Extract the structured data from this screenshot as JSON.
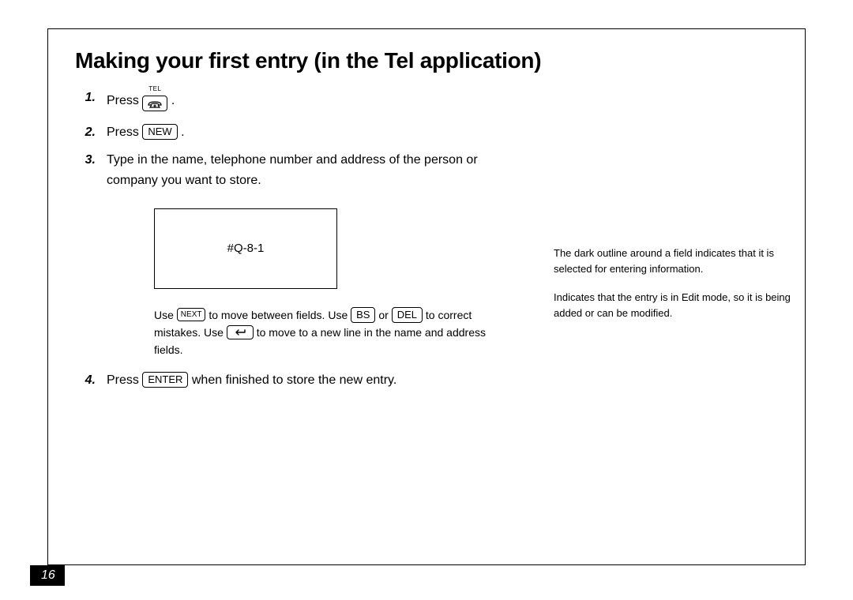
{
  "page_number": "16",
  "heading": "Making your first entry (in the Tel application)",
  "tel_label": "TEL",
  "steps": {
    "1": {
      "num": "1.",
      "press": "Press",
      "after": "."
    },
    "2": {
      "num": "2.",
      "press": "Press",
      "key": "NEW",
      "after": "."
    },
    "3": {
      "num": "3.",
      "text": "Type in the name, telephone number and address of the person or company you want to store."
    },
    "4": {
      "num": "4.",
      "press": "Press",
      "key": "ENTER",
      "after": " when finished to store the new entry."
    }
  },
  "screen_placeholder": "#Q-8-1",
  "sub": {
    "use": "Use ",
    "next": "NEXT",
    "t1": " to move between fields. Use ",
    "bs": "BS",
    "or": " or ",
    "del": "DEL",
    "t2": " to correct mistakes. Use ",
    "t3": " to move to a new line in the name and address fields."
  },
  "notes": {
    "n1": "The dark outline around a field indicates that it is selected for entering information.",
    "n2": "Indicates that the entry is in Edit mode, so it is being added or can be modified."
  }
}
